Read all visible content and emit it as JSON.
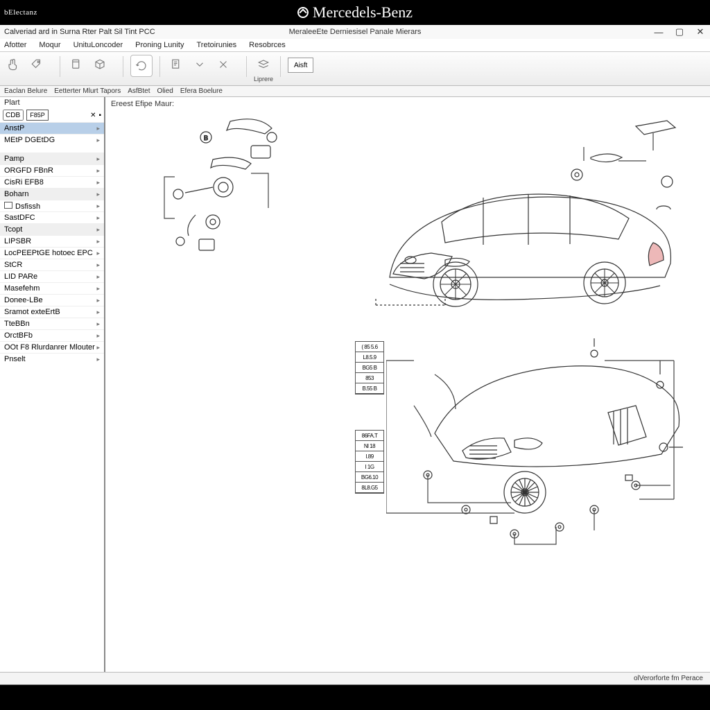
{
  "banner": {
    "left_label": "bElectanz",
    "brand": "Mercedels-Benz"
  },
  "titlebar": {
    "title_left": "Calveriad ard in Surna Rter Palt Sil Tint PCC",
    "title_center": "MeraleeEte Derniesisel Panale Mierars"
  },
  "menubar": [
    "Afotter",
    "Moqur",
    "UnituLoncoder",
    "Proning Lunity",
    "Tretoirunies",
    "Resobrces"
  ],
  "toolbar": {
    "labeled_btn": "Liprere",
    "text_btn": "Aisft"
  },
  "toolbar_captions": [
    "Eaclan Belure",
    "Eetterter Mlurt Tapors",
    "AsfBtet",
    "Olied",
    "Efera Boelure"
  ],
  "sidebar": {
    "header": "Plart",
    "search_a": "CDB",
    "search_b": "F85P",
    "items": [
      {
        "label": "AnstP",
        "kind": "selected"
      },
      {
        "label": "MEtP DGEtDG",
        "kind": "item"
      },
      {
        "label": "",
        "kind": "spacer"
      },
      {
        "label": "Pamp",
        "kind": "group"
      },
      {
        "label": "ORGFD FBnR",
        "kind": "item"
      },
      {
        "label": "CisRi EFB8",
        "kind": "item"
      },
      {
        "label": "Boharn",
        "kind": "group"
      },
      {
        "label": "Dsfissh",
        "kind": "check"
      },
      {
        "label": "SastDFC",
        "kind": "item"
      },
      {
        "label": "Tcopt",
        "kind": "group"
      },
      {
        "label": "LIPSBR",
        "kind": "item"
      },
      {
        "label": "LocPEEPtGE hotoec EPC",
        "kind": "item"
      },
      {
        "label": "StCR",
        "kind": "item"
      },
      {
        "label": "LID PARe",
        "kind": "item"
      },
      {
        "label": "Masefehm",
        "kind": "item"
      },
      {
        "label": "Donee-LBe",
        "kind": "item"
      },
      {
        "label": "Sramot exteErtB",
        "kind": "item"
      },
      {
        "label": "TteBBn",
        "kind": "item"
      },
      {
        "label": "OrctBFb",
        "kind": "item"
      },
      {
        "label": "OOt F8 Rlurdanrer Mlouter",
        "kind": "item"
      },
      {
        "label": "Pnselt",
        "kind": "item"
      }
    ]
  },
  "canvas": {
    "diagram_title": "Ereest Efipe Maur:",
    "part_labels_top": [
      "( 85 5.6",
      "L8.5.9",
      "BG5 B",
      "853",
      "B.55 B"
    ],
    "part_labels_bot": [
      "86FA.T",
      "Nl  18",
      "I.89",
      "I 1G",
      "BG6.10",
      "8L8.G5"
    ]
  },
  "statusbar": {
    "text": "olVerorforte fm Perace"
  },
  "colors": {
    "accent": "#b8cfe8"
  }
}
